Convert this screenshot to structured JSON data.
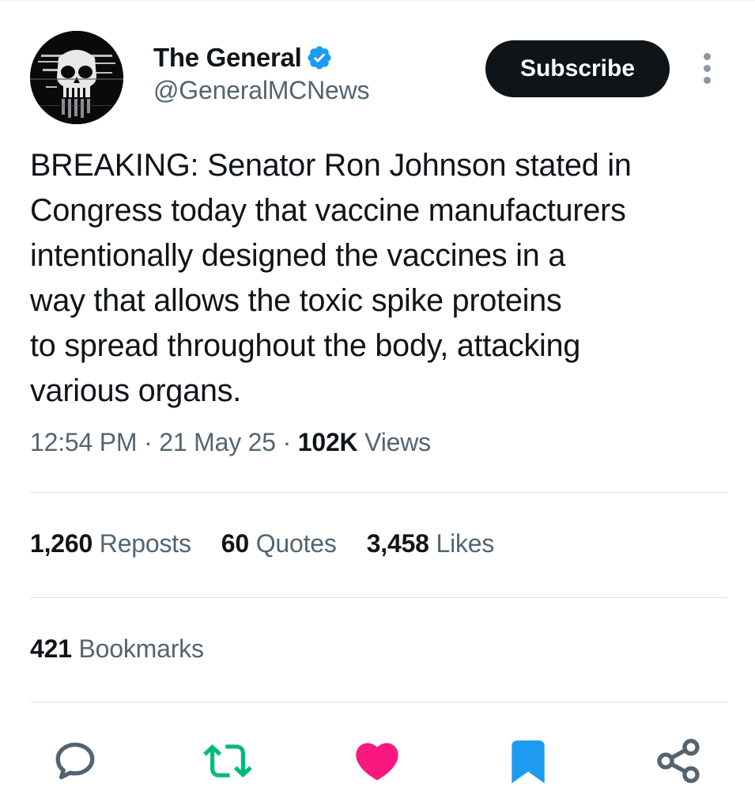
{
  "author": {
    "display_name": "The General",
    "handle": "@GeneralMCNews",
    "verified": true,
    "verified_color": "#1d9bf0"
  },
  "header": {
    "subscribe_label": "Subscribe"
  },
  "tweet": {
    "text_lines": [
      "BREAKING: Senator Ron Johnson stated in",
      "Congress today that vaccine manufacturers",
      "intentionally designed the vaccines in a",
      "way that allows the toxic spike proteins",
      "to spread throughout the body, attacking",
      "various organs."
    ],
    "time": "12:54 PM",
    "date": "21 May 25",
    "separator": "·",
    "views_count": "102K",
    "views_label": "Views"
  },
  "stats": {
    "reposts_count": "1,260",
    "reposts_label": "Reposts",
    "quotes_count": "60",
    "quotes_label": "Quotes",
    "likes_count": "3,458",
    "likes_label": "Likes",
    "bookmarks_count": "421",
    "bookmarks_label": "Bookmarks"
  },
  "actions": [
    {
      "name": "reply",
      "icon": "speech-bubble-icon",
      "color": "#536471"
    },
    {
      "name": "repost",
      "icon": "repost-arrows-icon",
      "color": "#00ba7c"
    },
    {
      "name": "like",
      "icon": "heart-icon",
      "color": "#f91880"
    },
    {
      "name": "bookmark",
      "icon": "bookmark-icon",
      "color": "#1d9bf0"
    },
    {
      "name": "share",
      "icon": "share-nodes-icon",
      "color": "#536471"
    }
  ],
  "colors": {
    "text_primary": "#0f1419",
    "text_secondary": "#536471",
    "button_dark": "#0f1419"
  }
}
